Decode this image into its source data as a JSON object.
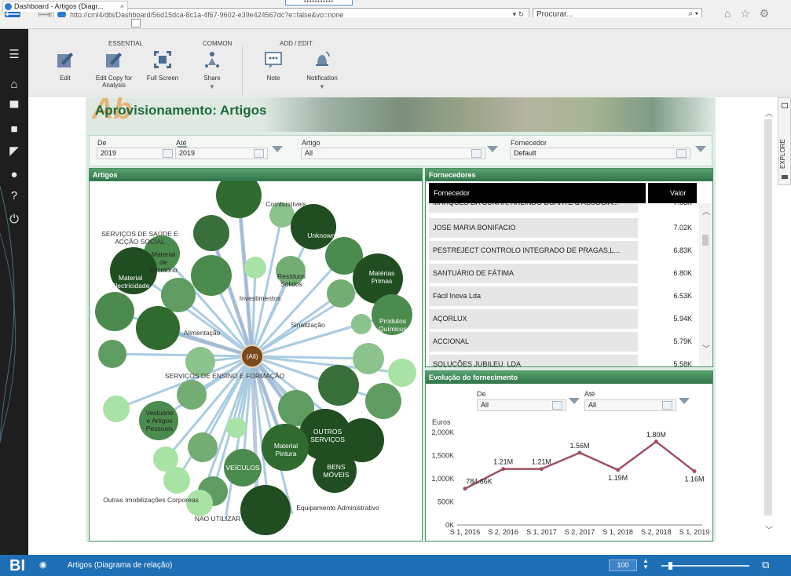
{
  "browser": {
    "tooltip_text": "•••••••••••",
    "url": "http://cml4/dbi/Dashboard/56d15dca-8c1a-4f67-9602-e39e424567dc?e=false&vo=none",
    "url_tail": "▾ ↻",
    "search_placeholder": "Procurar...",
    "search_tail": "⌕ ▾",
    "tab_title": "Dashboard - Artigos (Diagr...",
    "tab_close": "×",
    "toolbar_icons": "⌂ ☆ ⚙",
    "smiley": "☺"
  },
  "ribbon": {
    "groups": {
      "essential": "ESSENTIAL",
      "common": "COMMON",
      "add_edit": "ADD / EDIT"
    },
    "buttons": {
      "edit": "Edit",
      "edit_copy": "Edit Copy for Analysis",
      "full_screen": "Full Screen",
      "share": "Share",
      "note": "Note",
      "notification": "Notification"
    }
  },
  "dashboard": {
    "title": "Aprovisionamento: Artigos",
    "logo_text": "Ab",
    "filters": {
      "de_label": "De",
      "de_value": "2019",
      "ate_label": "Até",
      "ate_value": "2019",
      "artigo_label": "Artigo",
      "artigo_value": "All",
      "fornecedor_label": "Fornecedor",
      "fornecedor_value": "Default"
    },
    "artigos_panel": {
      "title": "Artigos",
      "center_label": "(All)",
      "labels": {
        "combustiveis": "Combustíveis",
        "unknown": "Unknown",
        "saude1": "SERVIÇOS DE SAÚDE E",
        "saude2": "ACÇÃO SOCIAL",
        "escritorio1": "Material",
        "escritorio2": "de",
        "escritorio3": "Escritório",
        "residuos1": "Resíduos",
        "residuos2": "Sólidos",
        "materias1": "Matérias",
        "materias2": "Primas",
        "electricidade1": "Material",
        "electricidade2": "Electricidade",
        "investimentos": "Investimentos",
        "quimicos1": "Produtos",
        "quimicos2": "Químicos",
        "sinalizacao": "Sinalização",
        "alimentacao": "Alimentação",
        "ensino": "SERVIÇOS DE ENSINO E FORMAÇÃO",
        "vestuario1": "Vestuário",
        "vestuario2": "e Artigos",
        "vestuario3": "Pessoais",
        "outros1": "OUTROS",
        "outros2": "SERVIÇOS",
        "pintura1": "Material",
        "pintura2": "Pintura",
        "veiculos": "VEÍCULOS",
        "bens1": "BENS",
        "bens2": "MÓVEIS",
        "imobilizacoes": "Outras Imobilizações Corporeas",
        "equipamento": "Equipamento Administrativo",
        "nao_utilizar": "NAO UTILIZAR"
      }
    },
    "fornecedores_panel": {
      "title": "Fornecedores",
      "col_fornecedor": "Fornecedor",
      "col_valor": "Valor",
      "rows": [
        {
          "name": "MARQUES DA CUNHA, ARLINDO DUARTE & ASSOCIA...",
          "value": "7.08K"
        },
        {
          "name": "JOSE MARIA BONIFACIO",
          "value": "7.02K"
        },
        {
          "name": "PESTREJECT CONTROLO INTEGRADO DE PRAGAS,L...",
          "value": "6.83K"
        },
        {
          "name": "SANTUÁRIO DE FÁTIMA",
          "value": "6.80K"
        },
        {
          "name": "Fácil Inova Lda",
          "value": "6.53K"
        },
        {
          "name": "AÇORLUX",
          "value": "5.94K"
        },
        {
          "name": "ACCIONAL",
          "value": "5.79K"
        },
        {
          "name": "SOLUÇÕES JUBILEU, LDA",
          "value": "5.58K"
        }
      ]
    },
    "evolucao_panel": {
      "title": "Evolução do fornecimento",
      "de_label": "De",
      "de_value": "All",
      "ate_label": "Até",
      "ate_value": "All"
    }
  },
  "chart_data": {
    "type": "line",
    "ylabel": "Euros",
    "categories": [
      "S 1, 2016",
      "S 2, 2016",
      "S 1, 2017",
      "S 2, 2017",
      "S 1, 2018",
      "S 2, 2018",
      "S 1, 2019"
    ],
    "values": [
      784660,
      1210000,
      1210000,
      1560000,
      1190000,
      1800000,
      1160000
    ],
    "data_labels": [
      "784.66K",
      "1.21M",
      "1.21M",
      "1.56M",
      "1.19M",
      "1.80M",
      "1.16M"
    ],
    "y_ticks": [
      "0K",
      "500K",
      "1,000K",
      "1,500K",
      "2,000K"
    ],
    "ylim": [
      0,
      2000000
    ],
    "color": "#a0505f",
    "grid": false
  },
  "side": {
    "explore": "EXPLORE"
  },
  "status": {
    "logo": "BI",
    "label": "Artigos (Diagrama de relação)",
    "zoom": "100"
  }
}
